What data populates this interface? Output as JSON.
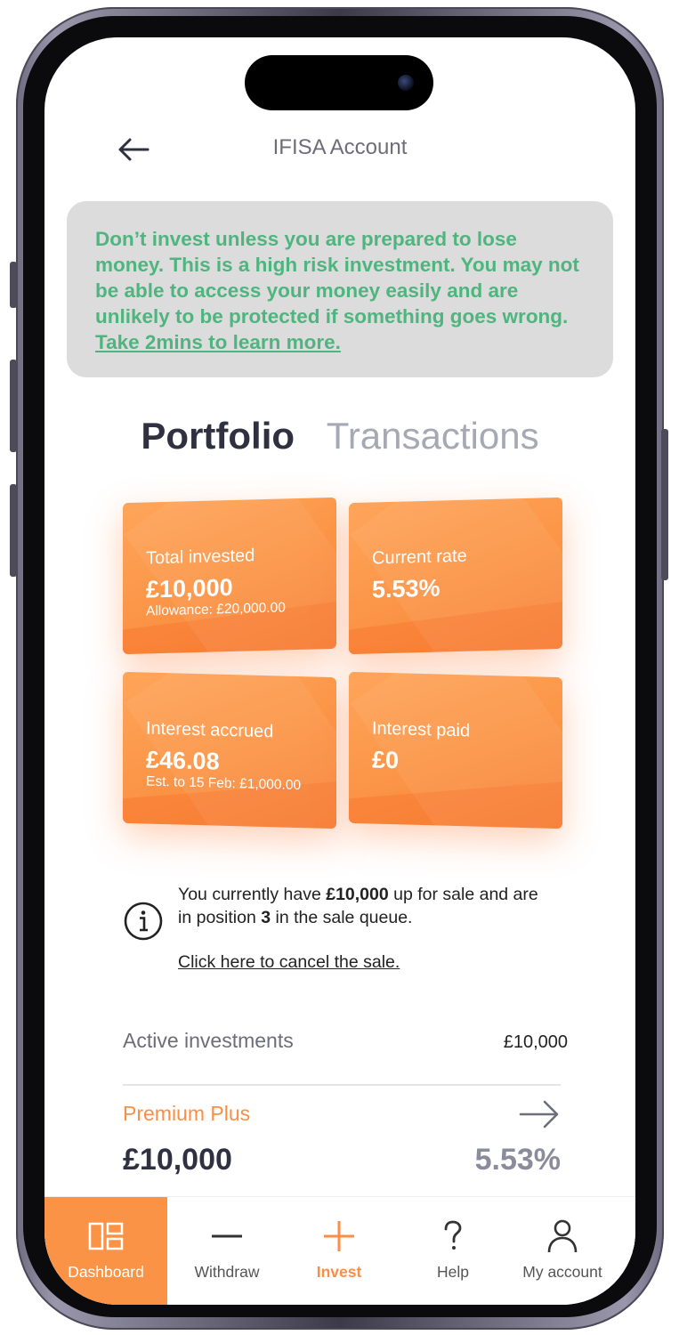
{
  "header": {
    "title": "IFISA Account",
    "back_icon": "arrow-left-icon"
  },
  "warning": {
    "text": "Don’t invest unless you are prepared to lose money. This is a high risk investment. You may not be able to access your money easily and are unlikely to be protected if something goes wrong. ",
    "link": "Take 2mins to learn more.",
    "color": "#4fb57f"
  },
  "tabs": [
    {
      "label": "Portfolio",
      "active": true
    },
    {
      "label": "Transactions",
      "active": false
    }
  ],
  "cards": [
    {
      "label": "Total invested",
      "value": "£10,000",
      "sub": "Allowance: £20,000.00"
    },
    {
      "label": "Current rate",
      "value": "5.53%",
      "sub": ""
    },
    {
      "label": "Interest accrued",
      "value": "£46.08",
      "sub": "Est. to 15 Feb: £1,000.00"
    },
    {
      "label": "Interest paid",
      "value": "£0",
      "sub": ""
    }
  ],
  "info": {
    "icon": "info-icon",
    "text_1": "You currently have ",
    "amount": "£10,000",
    "text_2": " up for sale and are in position ",
    "position": "3",
    "text_3": " in the sale queue.",
    "link": "Click here to cancel the sale."
  },
  "active_investments": {
    "label": "Active investments",
    "amount": "£10,000"
  },
  "investments": [
    {
      "name": "Premium Plus",
      "amount": "£10,000",
      "rate": "5.53%",
      "icon": "arrow-right-icon"
    }
  ],
  "nav": [
    {
      "label": "Dashboard",
      "icon": "dashboard-icon",
      "active": true
    },
    {
      "label": "Withdraw",
      "icon": "minus-icon",
      "active": false
    },
    {
      "label": "Invest",
      "icon": "plus-icon",
      "active": false
    },
    {
      "label": "Help",
      "icon": "question-icon",
      "active": false
    },
    {
      "label": "My account",
      "icon": "user-icon",
      "active": false
    }
  ],
  "colors": {
    "accent": "#fb9346",
    "warning_green": "#4fb57f",
    "text_dark": "#2f3140"
  }
}
